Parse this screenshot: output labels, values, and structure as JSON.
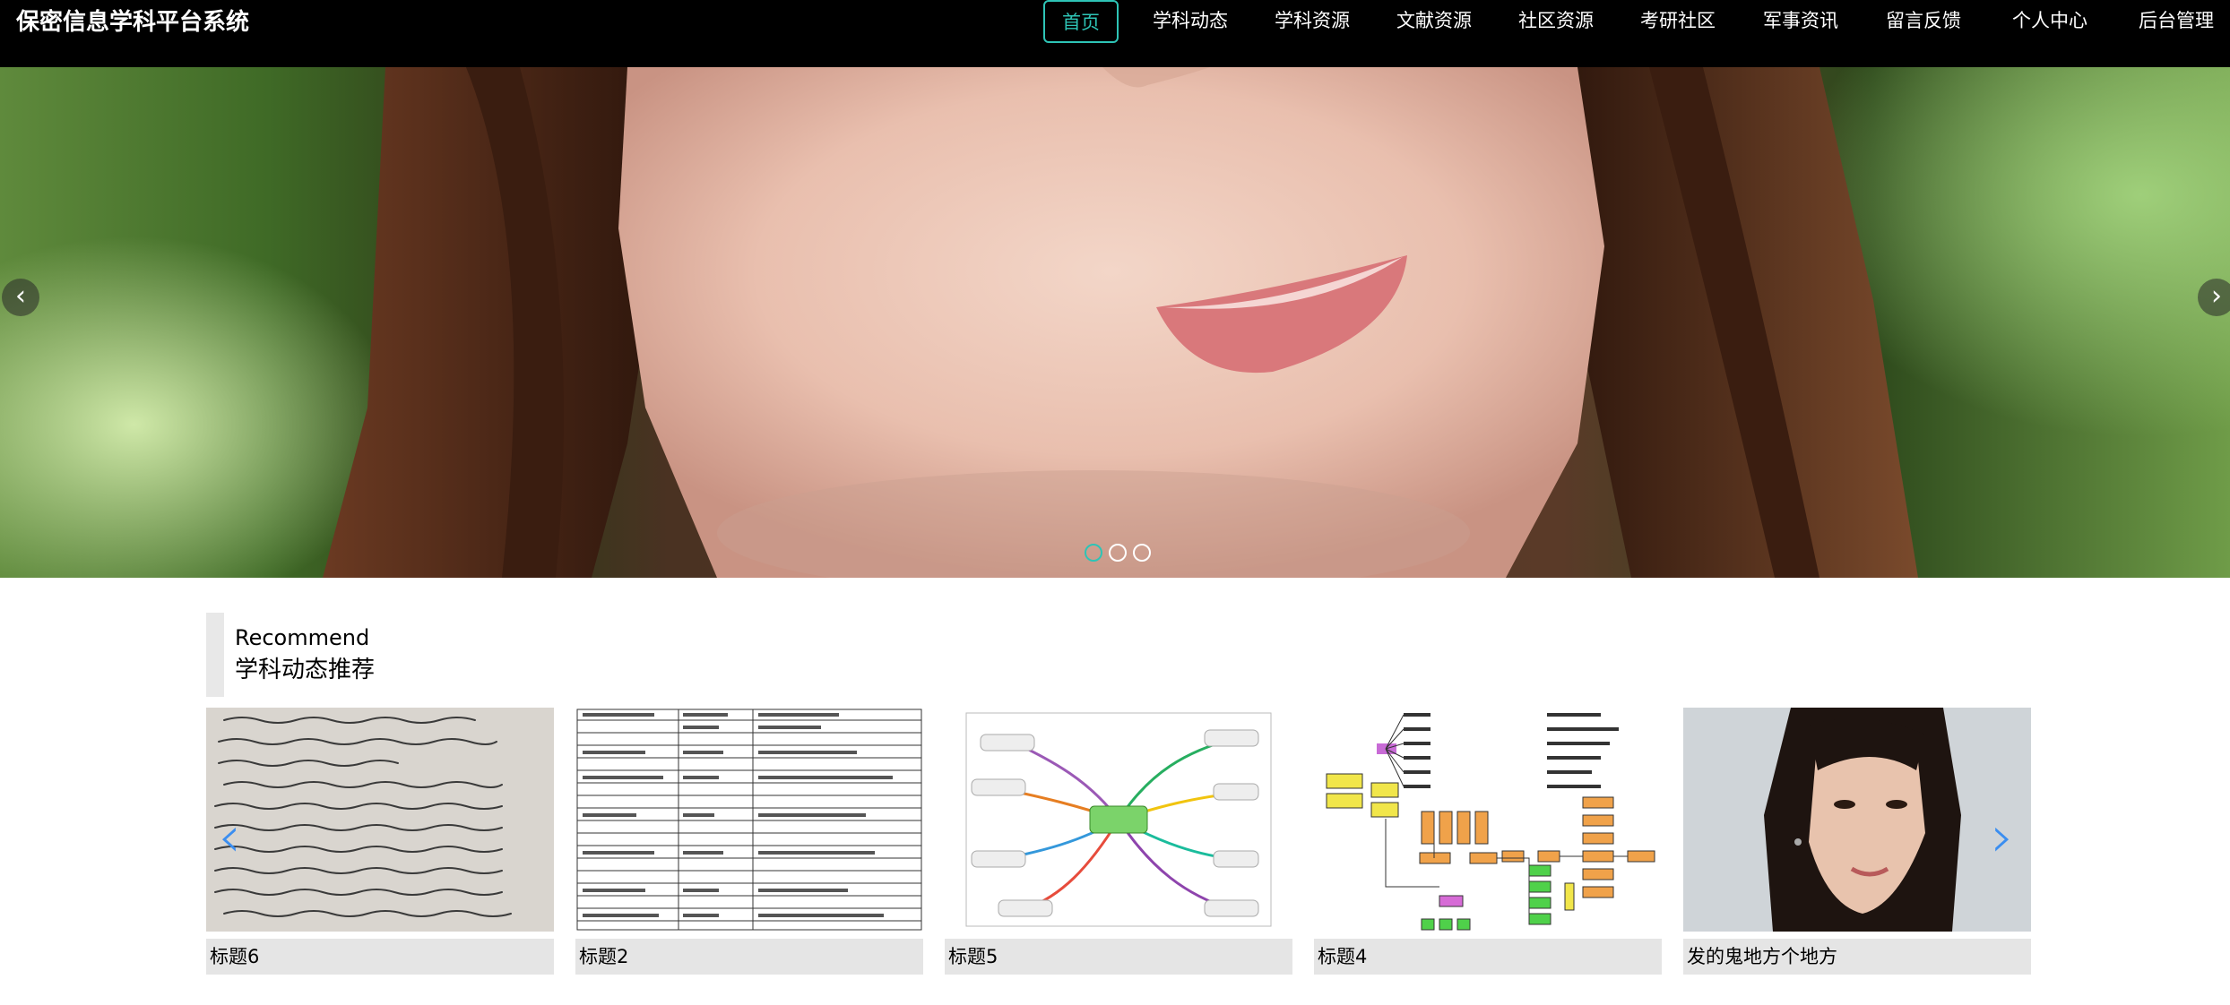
{
  "header": {
    "brand": "保密信息学科平台系统",
    "nav": [
      {
        "label": "首页",
        "active": true
      },
      {
        "label": "学科动态"
      },
      {
        "label": "学科资源"
      },
      {
        "label": "文献资源"
      },
      {
        "label": "社区资源"
      },
      {
        "label": "考研社区"
      },
      {
        "label": "军事资讯"
      },
      {
        "label": "留言反馈"
      },
      {
        "label": "个人中心"
      },
      {
        "label": "后台管理"
      }
    ]
  },
  "hero": {
    "prev_icon": "chevron-left-icon",
    "next_icon": "chevron-right-icon",
    "prev_glyph": "‹",
    "next_glyph": "›",
    "slide_count": 3,
    "active_slide": 1
  },
  "recommend": {
    "title_en": "Recommend",
    "title_cn": "学科动态推荐",
    "items": [
      {
        "caption": "标题6"
      },
      {
        "caption": "标题2"
      },
      {
        "caption": "标题5"
      },
      {
        "caption": "标题4"
      },
      {
        "caption": "发的鬼地方个地方"
      }
    ],
    "prev_glyph": "‹",
    "next_glyph": "›"
  },
  "colors": {
    "header_bg": "#000000",
    "accent": "#2ec4b6",
    "arrow_blue": "#3b8ef0",
    "caption_bg": "#e5e5e5"
  }
}
